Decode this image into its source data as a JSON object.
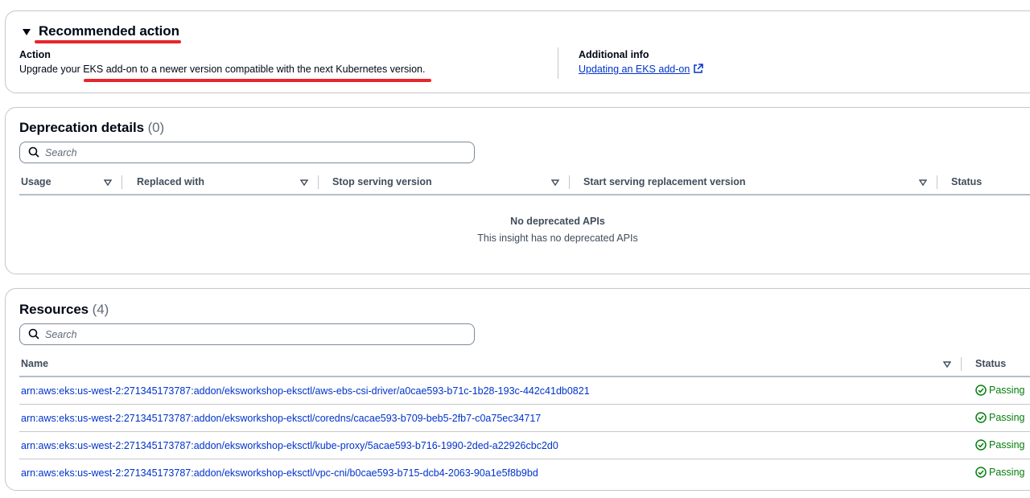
{
  "recommended_action": {
    "title": "Recommended action",
    "action_label": "Action",
    "action_text": "Upgrade your EKS add-on to a newer version compatible with the next Kubernetes version.",
    "additional_info_label": "Additional info",
    "link_text": "Updating an EKS add-on"
  },
  "deprecation": {
    "title": "Deprecation details",
    "count": "(0)",
    "search_placeholder": "Search",
    "columns": [
      "Usage",
      "Replaced with",
      "Stop serving version",
      "Start serving replacement version",
      "Status"
    ],
    "empty_title": "No deprecated APIs",
    "empty_text": "This insight has no deprecated APIs"
  },
  "resources": {
    "title": "Resources",
    "count": "(4)",
    "search_placeholder": "Search",
    "columns": [
      "Name",
      "Status"
    ],
    "rows": [
      {
        "name": "arn:aws:eks:us-west-2:271345173787:addon/eksworkshop-eksctl/aws-ebs-csi-driver/a0cae593-b71c-1b28-193c-442c41db0821",
        "status": "Passing"
      },
      {
        "name": "arn:aws:eks:us-west-2:271345173787:addon/eksworkshop-eksctl/coredns/cacae593-b709-beb5-2fb7-c0a75ec34717",
        "status": "Passing"
      },
      {
        "name": "arn:aws:eks:us-west-2:271345173787:addon/eksworkshop-eksctl/kube-proxy/5acae593-b716-1990-2ded-a22926cbc2d0",
        "status": "Passing"
      },
      {
        "name": "arn:aws:eks:us-west-2:271345173787:addon/eksworkshop-eksctl/vpc-cni/b0cae593-b715-dcb4-2063-90a1e5f8b9bd",
        "status": "Passing"
      }
    ]
  },
  "colors": {
    "link": "#0033cc",
    "passing": "#037f0c",
    "annotation_underline": "#e8242c",
    "border": "#c6c6cd"
  },
  "icons": [
    "caret-down-icon",
    "external-link-icon",
    "search-icon",
    "sort-icon",
    "check-circle-icon"
  ]
}
